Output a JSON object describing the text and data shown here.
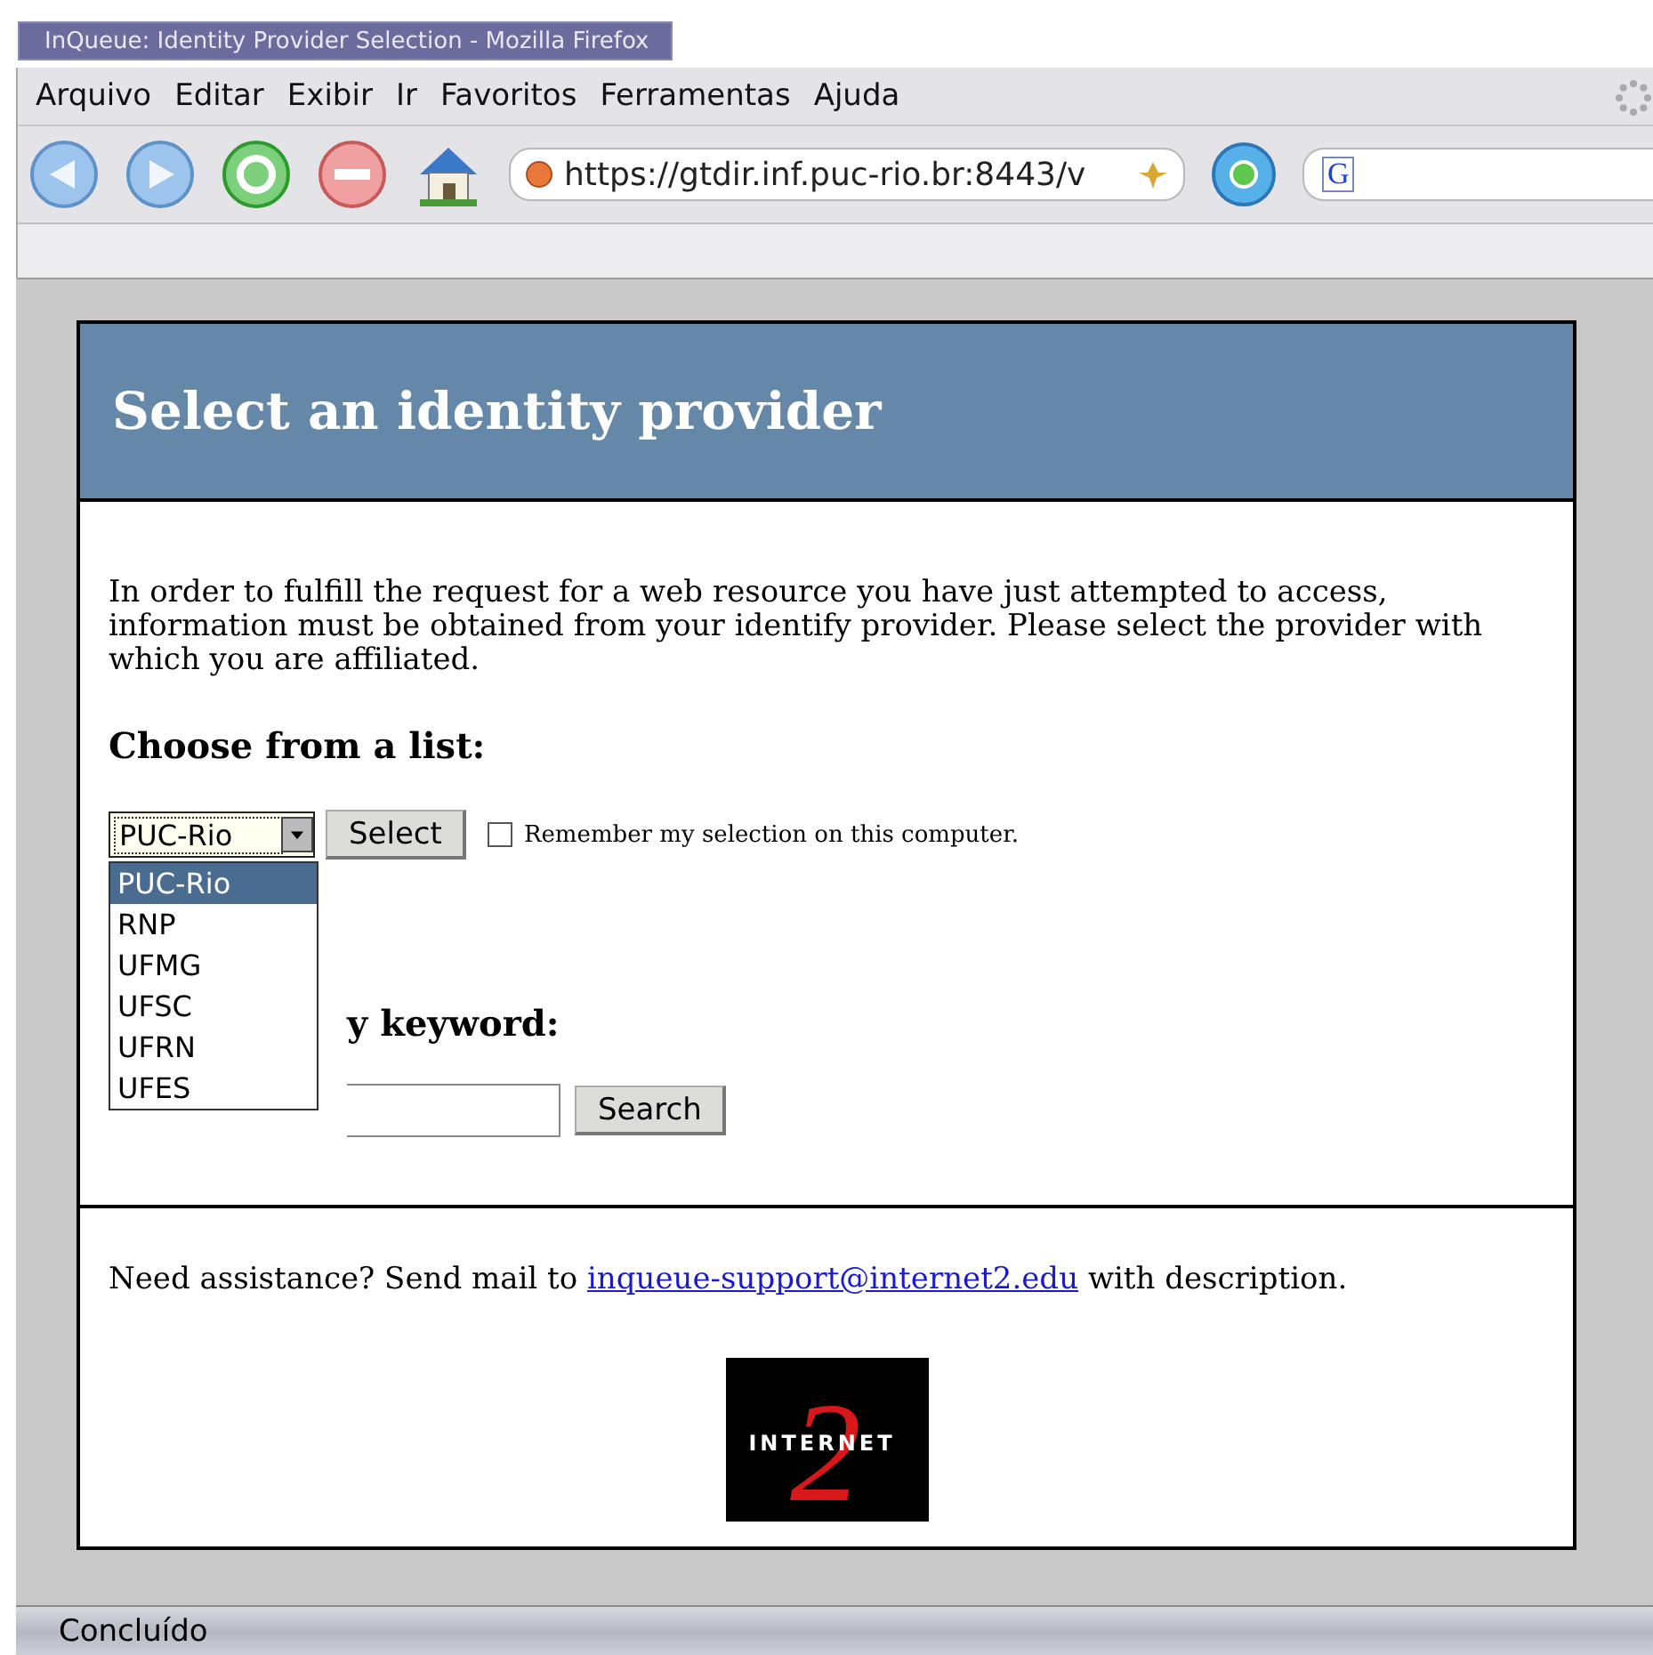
{
  "window": {
    "title": "InQueue: Identity Provider Selection - Mozilla Firefox"
  },
  "menu": [
    "Arquivo",
    "Editar",
    "Exibir",
    "Ir",
    "Favoritos",
    "Ferramentas",
    "Ajuda"
  ],
  "address_bar": {
    "value": "https://gtdir.inf.puc-rio.br:8443/v"
  },
  "search_bar": {
    "engine_letter": "G"
  },
  "page": {
    "heading": "Select an identity provider",
    "intro": "In order to fulfill the request for a web resource you have just attempted to access, information must be obtained from your identify provider. Please select the provider with which you are affiliated.",
    "list_heading": "Choose from a list:",
    "dropdown": {
      "value": "PUC-Rio",
      "expanded": true,
      "options": [
        {
          "label": "PUC-Rio",
          "selected": true
        },
        {
          "label": "RNP",
          "selected": false
        },
        {
          "label": "UFMG",
          "selected": false
        },
        {
          "label": "UFSC",
          "selected": false
        },
        {
          "label": "UFRN",
          "selected": false
        },
        {
          "label": "UFES",
          "selected": false
        }
      ]
    },
    "select_button": "Select",
    "remember": {
      "label": "Remember my selection on this computer.",
      "checked": false
    },
    "keyword_heading": "y keyword:",
    "search_button": "Search",
    "assistance_before": "Need assistance? Send mail to",
    "assistance_link": "inqueue-support@internet2.edu",
    "assistance_after": "with description.",
    "logo": {
      "word": "INTERNET",
      "numeral": "2"
    }
  },
  "status_bar": "Concluído"
}
